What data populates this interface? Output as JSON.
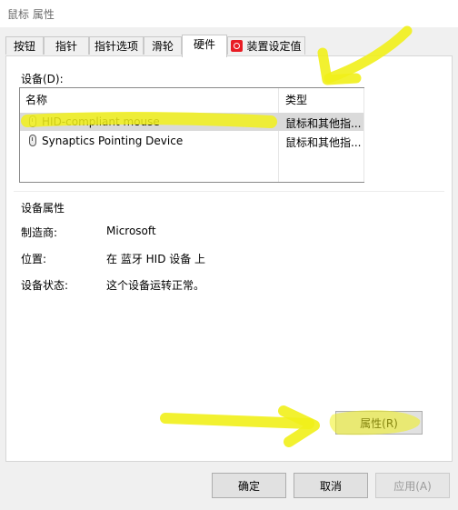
{
  "window": {
    "title": "鼠标 属性"
  },
  "tabs": [
    {
      "label": "按钮",
      "active": false
    },
    {
      "label": "指针",
      "active": false
    },
    {
      "label": "指针选项",
      "active": false
    },
    {
      "label": "滑轮",
      "active": false
    },
    {
      "label": "硬件",
      "active": true
    },
    {
      "label": "装置设定值",
      "active": false,
      "icon": "synaptics-icon"
    }
  ],
  "devices": {
    "label": "设备(D):",
    "columns": [
      "名称",
      "类型"
    ],
    "rows": [
      {
        "name": "HID-compliant mouse",
        "type": "鼠标和其他指...",
        "selected": true,
        "icon": "mouse-icon"
      },
      {
        "name": "Synaptics Pointing Device",
        "type": "鼠标和其他指...",
        "selected": false,
        "icon": "mouse-icon"
      }
    ]
  },
  "properties": {
    "group_title": "设备属性",
    "manufacturer_label": "制造商:",
    "manufacturer_value": "Microsoft",
    "location_label": "位置:",
    "location_value": "在 蓝牙 HID 设备 上",
    "status_label": "设备状态:",
    "status_value": "这个设备运转正常。",
    "button_label": "属性(R)"
  },
  "footer": {
    "ok_label": "确定",
    "cancel_label": "取消",
    "apply_label": "应用(A)"
  },
  "colors": {
    "highlight": "#f1f01a",
    "selection": "#dadada"
  }
}
